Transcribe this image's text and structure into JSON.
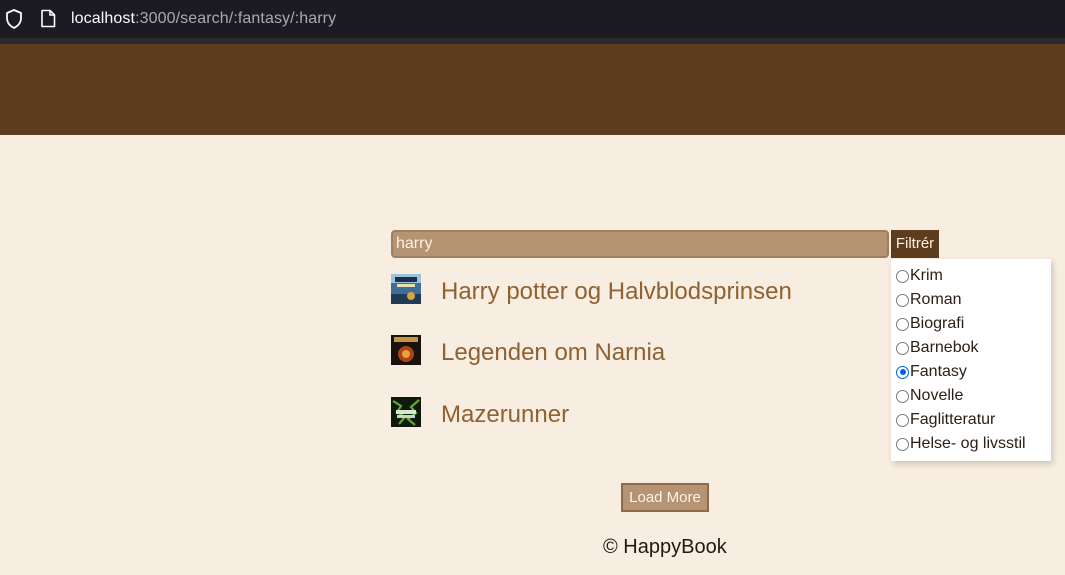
{
  "browser": {
    "url_host": "localhost",
    "url_path": ":3000/search/:fantasy/:harry"
  },
  "search": {
    "value": "harry",
    "filter_label": "Filtrér"
  },
  "filter": {
    "options": [
      {
        "label": "Krim",
        "checked": false
      },
      {
        "label": "Roman",
        "checked": false
      },
      {
        "label": "Biografi",
        "checked": false
      },
      {
        "label": "Barnebok",
        "checked": false
      },
      {
        "label": "Fantasy",
        "checked": true
      },
      {
        "label": "Novelle",
        "checked": false
      },
      {
        "label": "Faglitteratur",
        "checked": false
      },
      {
        "label": "Helse- og livsstil",
        "checked": false
      }
    ]
  },
  "results": [
    {
      "title": "Harry potter og Halvblodsprinsen"
    },
    {
      "title": "Legenden om Narnia"
    },
    {
      "title": "Mazerunner"
    }
  ],
  "load_more_label": "Load More",
  "footer": {
    "text": "© HappyBook"
  },
  "colors": {
    "header": "#5e3d1e",
    "background": "#f8ede1",
    "input": "#b59373",
    "result_title": "#8f6233",
    "radio_checked": "#0060df"
  }
}
